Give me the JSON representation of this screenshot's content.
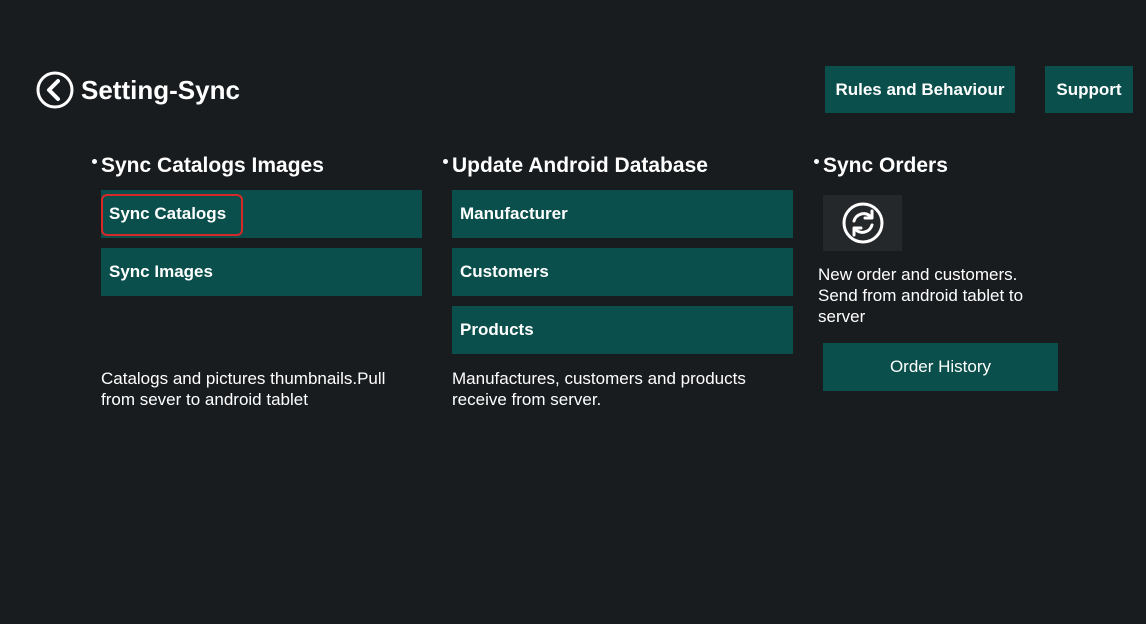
{
  "header": {
    "title": "Setting-Sync",
    "back_icon": "chevron-left-circle-icon",
    "rules_label": "Rules and Behaviour",
    "support_label": "Support"
  },
  "sections": {
    "catalogs": {
      "heading": "Sync Catalogs Images",
      "buttons": [
        "Sync Catalogs",
        "Sync Images"
      ],
      "description": "Catalogs and pictures thumbnails.Pull from sever to android tablet"
    },
    "database": {
      "heading": "Update Android Database",
      "buttons": [
        "Manufacturer",
        "Customers",
        "Products"
      ],
      "description": "Manufactures, customers and products receive from server."
    },
    "orders": {
      "heading": "Sync Orders",
      "sync_icon": "sync-refresh-icon",
      "description": "New order and customers. Send from android tablet to server",
      "order_history_label": "Order History"
    }
  },
  "colors": {
    "background": "#181c1f",
    "button": "#0a4f4b",
    "highlight": "#d62828",
    "icon_box": "#25282b"
  }
}
